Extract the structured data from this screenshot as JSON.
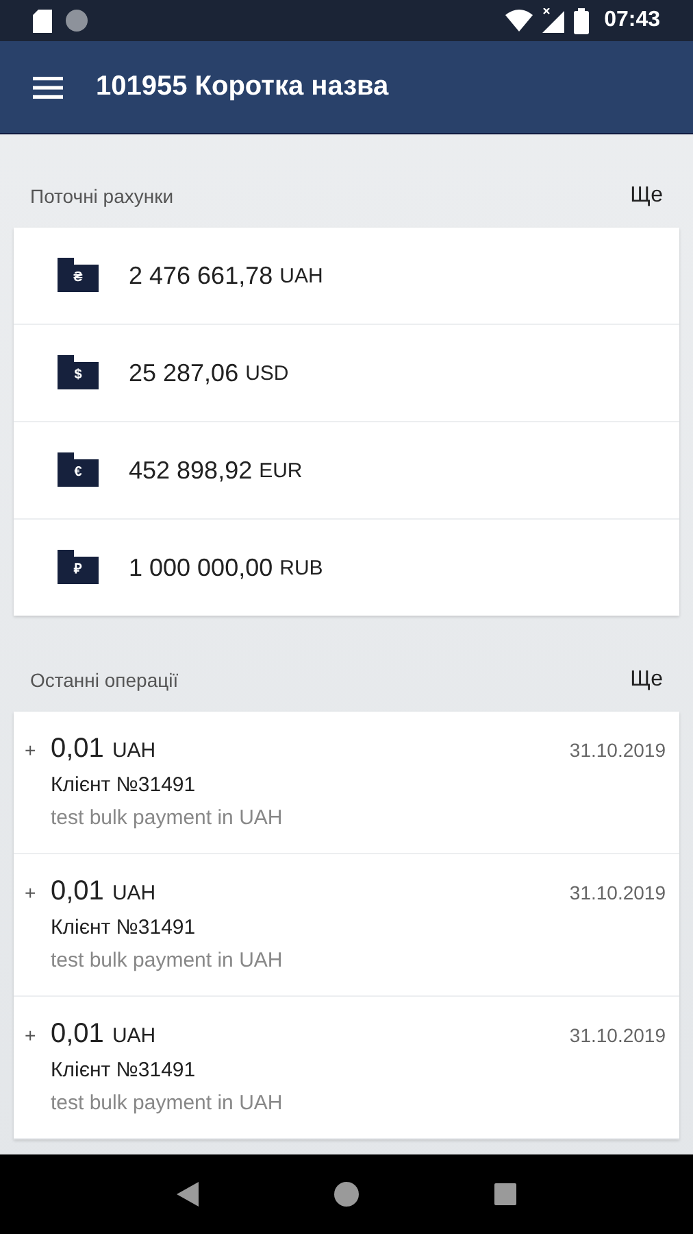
{
  "status_bar": {
    "time": "07:43"
  },
  "app_bar": {
    "title": "101955 Коротка назва"
  },
  "accounts": {
    "title": "Поточні рахунки",
    "more": "Ще",
    "items": [
      {
        "symbol": "₴",
        "amount": "2 476 661,78",
        "currency": "UAH"
      },
      {
        "symbol": "$",
        "amount": "25 287,06",
        "currency": "USD"
      },
      {
        "symbol": "€",
        "amount": "452 898,92",
        "currency": "EUR"
      },
      {
        "symbol": "₽",
        "amount": "1 000 000,00",
        "currency": "RUB"
      }
    ]
  },
  "operations": {
    "title": "Останні операції",
    "more": "Ще",
    "items": [
      {
        "sign": "+",
        "amount": "0,01",
        "currency": "UAH",
        "date": "31.10.2019",
        "client": "Клієнт №31491",
        "description": "test bulk payment in UAH"
      },
      {
        "sign": "+",
        "amount": "0,01",
        "currency": "UAH",
        "date": "31.10.2019",
        "client": "Клієнт №31491",
        "description": "test bulk payment in UAH"
      },
      {
        "sign": "+",
        "amount": "0,01",
        "currency": "UAH",
        "date": "31.10.2019",
        "client": "Клієнт №31491",
        "description": "test bulk payment in UAH"
      }
    ]
  }
}
